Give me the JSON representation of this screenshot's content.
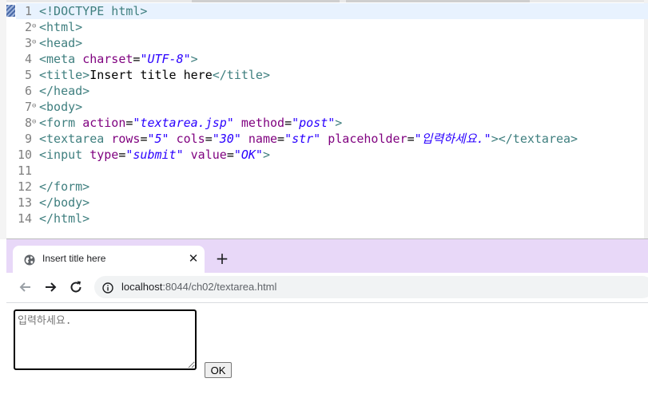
{
  "editor": {
    "lines": [
      {
        "n": "1",
        "fold": "",
        "current": true,
        "tokens": [
          [
            "doctype",
            "<!DOCTYPE html>"
          ]
        ]
      },
      {
        "n": "2",
        "fold": "⊖",
        "tokens": [
          [
            "tag",
            "<html>"
          ]
        ]
      },
      {
        "n": "3",
        "fold": "⊖",
        "tokens": [
          [
            "tag",
            "<head>"
          ]
        ]
      },
      {
        "n": "4",
        "fold": "",
        "tokens": [
          [
            "tag",
            "<meta "
          ],
          [
            "attr",
            "charset"
          ],
          [
            "txt",
            "="
          ],
          [
            "val",
            "\"UTF-8\""
          ],
          [
            "tag",
            ">"
          ]
        ]
      },
      {
        "n": "5",
        "fold": "",
        "tokens": [
          [
            "tag",
            "<title>"
          ],
          [
            "txt",
            "Insert title here"
          ],
          [
            "tag",
            "</title>"
          ]
        ]
      },
      {
        "n": "6",
        "fold": "",
        "tokens": [
          [
            "tag",
            "</head>"
          ]
        ]
      },
      {
        "n": "7",
        "fold": "⊖",
        "tokens": [
          [
            "tag",
            "<body>"
          ]
        ]
      },
      {
        "n": "8",
        "fold": "⊖",
        "tokens": [
          [
            "tag",
            "<form "
          ],
          [
            "attr",
            "action"
          ],
          [
            "txt",
            "="
          ],
          [
            "val",
            "\"textarea.jsp\""
          ],
          [
            "txt",
            " "
          ],
          [
            "attr",
            "method"
          ],
          [
            "txt",
            "="
          ],
          [
            "val",
            "\"post\""
          ],
          [
            "tag",
            ">"
          ]
        ]
      },
      {
        "n": "9",
        "fold": "",
        "tokens": [
          [
            "tag",
            "<textarea "
          ],
          [
            "attr",
            "rows"
          ],
          [
            "txt",
            "="
          ],
          [
            "val",
            "\"5\""
          ],
          [
            "txt",
            " "
          ],
          [
            "attr",
            "cols"
          ],
          [
            "txt",
            "="
          ],
          [
            "val",
            "\"30\""
          ],
          [
            "txt",
            " "
          ],
          [
            "attr",
            "name"
          ],
          [
            "txt",
            "="
          ],
          [
            "val",
            "\"str\""
          ],
          [
            "txt",
            " "
          ],
          [
            "attr",
            "placeholder"
          ],
          [
            "txt",
            "="
          ],
          [
            "val",
            "\"입력하세요.\""
          ],
          [
            "tag",
            "></textarea>"
          ]
        ]
      },
      {
        "n": "10",
        "fold": "",
        "tokens": [
          [
            "tag",
            "<input "
          ],
          [
            "attr",
            "type"
          ],
          [
            "txt",
            "="
          ],
          [
            "val",
            "\"submit\""
          ],
          [
            "txt",
            " "
          ],
          [
            "attr",
            "value"
          ],
          [
            "txt",
            "="
          ],
          [
            "val",
            "\"OK\""
          ],
          [
            "tag",
            ">"
          ]
        ]
      },
      {
        "n": "11",
        "fold": "",
        "tokens": []
      },
      {
        "n": "12",
        "fold": "",
        "tokens": [
          [
            "tag",
            "</form>"
          ]
        ]
      },
      {
        "n": "13",
        "fold": "",
        "tokens": [
          [
            "tag",
            "</body>"
          ]
        ]
      },
      {
        "n": "14",
        "fold": "",
        "tokens": [
          [
            "tag",
            "</html>"
          ]
        ]
      }
    ]
  },
  "browser": {
    "tab_title": "Insert title here",
    "tab_icon": "globe-icon",
    "close_glyph": "✕",
    "new_tab_glyph": "+",
    "url_host": "localhost",
    "url_path": ":8044/ch02/textarea.html",
    "textarea_placeholder": "입력하세요.",
    "submit_label": "OK"
  }
}
